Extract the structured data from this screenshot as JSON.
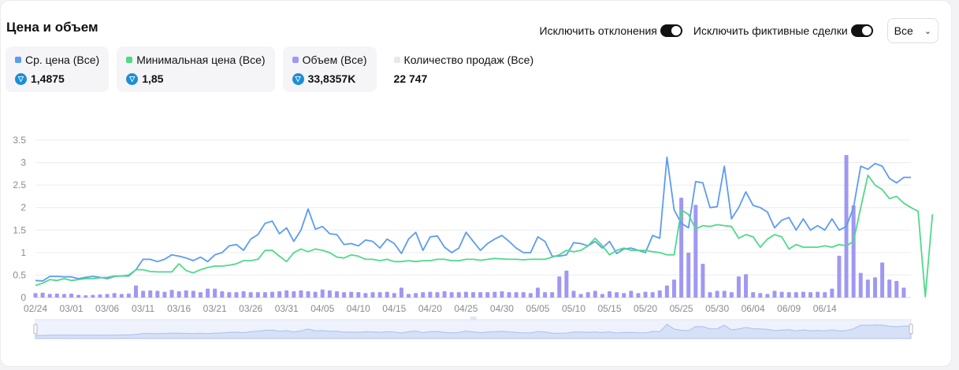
{
  "title": "Цена и объем",
  "controls": {
    "exclude_outliers_label": "Исключить отклонения",
    "exclude_wash_label": "Исключить фиктивные сделки",
    "select_value": "Все"
  },
  "stats": [
    {
      "label": "Ср. цена (Все)",
      "value": "1,4875",
      "color": "#5b9cf0",
      "icon": "ton-icon"
    },
    {
      "label": "Минимальная цена (Все)",
      "value": "1,85",
      "color": "#4fd98a",
      "icon": "ton-icon"
    },
    {
      "label": "Объем (Все)",
      "value": "33,8357K",
      "color": "#9f98f3",
      "icon": "ton-icon"
    },
    {
      "label": "Количество продаж (Все)",
      "value": "22 747",
      "color": "#e9e7ee"
    }
  ],
  "chart_data": {
    "type": "line",
    "title": "",
    "xlabel": "",
    "ylabel": "",
    "ylim": [
      0,
      3.5
    ],
    "yticks": [
      "0",
      "0.5",
      "1",
      "1.5",
      "2",
      "2.5",
      "3",
      "3.5"
    ],
    "xticks": [
      "02/24",
      "03/01",
      "03/06",
      "03/11",
      "03/16",
      "03/21",
      "03/26",
      "03/31",
      "04/05",
      "04/10",
      "04/15",
      "04/20",
      "04/25",
      "04/30",
      "05/05",
      "05/10",
      "05/15",
      "05/20",
      "05/25",
      "05/30",
      "06/04",
      "06/09",
      "06/14"
    ],
    "grid": true,
    "x_start": "02/24",
    "series": [
      {
        "name": "Ср. цена (Все)",
        "kind": "line",
        "color": "#5b9cf0",
        "values": [
          0.38,
          0.37,
          0.47,
          0.47,
          0.46,
          0.46,
          0.42,
          0.45,
          0.47,
          0.45,
          0.42,
          0.47,
          0.48,
          0.48,
          0.62,
          0.85,
          0.85,
          0.8,
          0.85,
          0.95,
          0.92,
          0.88,
          0.82,
          0.9,
          0.8,
          0.95,
          1.0,
          1.15,
          1.18,
          1.05,
          1.3,
          1.4,
          1.65,
          1.7,
          1.42,
          1.55,
          1.25,
          1.5,
          1.97,
          1.52,
          1.58,
          1.42,
          1.4,
          1.18,
          1.2,
          1.15,
          1.28,
          1.25,
          1.1,
          1.3,
          1.2,
          0.98,
          1.3,
          1.45,
          1.05,
          1.35,
          1.37,
          1.12,
          1.0,
          1.1,
          1.45,
          1.25,
          1.05,
          1.2,
          1.3,
          1.38,
          1.25,
          1.1,
          1.0,
          1.0,
          1.35,
          1.25,
          0.92,
          0.92,
          0.95,
          1.22,
          1.2,
          1.15,
          1.25,
          1.1,
          1.25,
          0.98,
          1.08,
          1.1,
          1.05,
          1.0,
          1.38,
          1.32,
          3.12,
          1.95,
          1.65,
          1.55,
          2.58,
          2.55,
          2.0,
          2.02,
          2.92,
          1.75,
          2.0,
          2.35,
          2.05,
          2.0,
          1.9,
          1.55,
          1.72,
          1.78,
          1.5,
          1.75,
          1.5,
          1.6,
          1.5,
          1.75,
          1.5,
          1.58,
          2.0,
          2.92,
          2.85,
          2.98,
          2.92,
          2.65,
          2.55,
          2.67,
          2.67
        ]
      },
      {
        "name": "Минимальная цена (Все)",
        "kind": "line",
        "color": "#4fd98a",
        "values": [
          0.27,
          0.32,
          0.4,
          0.38,
          0.42,
          0.38,
          0.4,
          0.42,
          0.42,
          0.44,
          0.45,
          0.48,
          0.48,
          0.5,
          0.62,
          0.62,
          0.58,
          0.57,
          0.57,
          0.57,
          0.75,
          0.6,
          0.55,
          0.62,
          0.67,
          0.7,
          0.7,
          0.72,
          0.75,
          0.82,
          0.82,
          0.85,
          1.05,
          1.05,
          0.92,
          0.8,
          1.0,
          1.08,
          1.02,
          1.08,
          1.05,
          1.0,
          0.9,
          0.88,
          0.95,
          0.92,
          0.85,
          0.85,
          0.82,
          0.85,
          0.8,
          0.8,
          0.82,
          0.8,
          0.82,
          0.82,
          0.85,
          0.85,
          0.82,
          0.82,
          0.85,
          0.85,
          0.83,
          0.85,
          0.87,
          0.86,
          0.85,
          0.85,
          0.84,
          0.85,
          0.85,
          0.85,
          0.9,
          0.95,
          1.05,
          1.02,
          1.05,
          1.15,
          1.32,
          1.15,
          0.95,
          1.05,
          1.1,
          1.05,
          1.05,
          1.05,
          1.02,
          1.0,
          0.95,
          0.95,
          1.95,
          1.85,
          1.52,
          1.6,
          1.58,
          1.62,
          1.6,
          1.58,
          1.32,
          1.4,
          1.35,
          1.12,
          1.3,
          1.4,
          1.35,
          1.08,
          1.18,
          1.12,
          1.12,
          1.12,
          1.15,
          1.12,
          1.18,
          1.15,
          1.25,
          2.0,
          2.72,
          2.5,
          2.4,
          2.2,
          2.25,
          2.1,
          2.0,
          1.92,
          0.02,
          1.85
        ]
      },
      {
        "name": "Объем (Все)",
        "kind": "bar",
        "color": "#9f98f3",
        "values": [
          0.1,
          0.11,
          0.08,
          0.09,
          0.08,
          0.09,
          0.06,
          0.05,
          0.06,
          0.07,
          0.08,
          0.1,
          0.08,
          0.09,
          0.27,
          0.15,
          0.16,
          0.15,
          0.13,
          0.17,
          0.14,
          0.16,
          0.15,
          0.12,
          0.2,
          0.2,
          0.14,
          0.12,
          0.12,
          0.14,
          0.12,
          0.12,
          0.12,
          0.13,
          0.14,
          0.16,
          0.14,
          0.16,
          0.14,
          0.13,
          0.18,
          0.16,
          0.14,
          0.12,
          0.13,
          0.12,
          0.1,
          0.12,
          0.12,
          0.13,
          0.1,
          0.22,
          0.08,
          0.1,
          0.12,
          0.13,
          0.12,
          0.14,
          0.12,
          0.12,
          0.13,
          0.12,
          0.12,
          0.12,
          0.13,
          0.14,
          0.12,
          0.12,
          0.12,
          0.1,
          0.22,
          0.12,
          0.12,
          0.47,
          0.6,
          0.15,
          0.08,
          0.12,
          0.15,
          0.08,
          0.14,
          0.12,
          0.1,
          0.15,
          0.1,
          0.13,
          0.12,
          0.16,
          0.27,
          0.4,
          2.22,
          1.0,
          2.06,
          0.75,
          0.12,
          0.15,
          0.15,
          0.12,
          0.47,
          0.52,
          0.12,
          0.1,
          0.08,
          0.15,
          0.13,
          0.12,
          0.12,
          0.13,
          0.12,
          0.13,
          0.12,
          0.2,
          0.93,
          3.17,
          2.05,
          0.55,
          0.4,
          0.45,
          0.78,
          0.4,
          0.37,
          0.22
        ]
      }
    ]
  }
}
